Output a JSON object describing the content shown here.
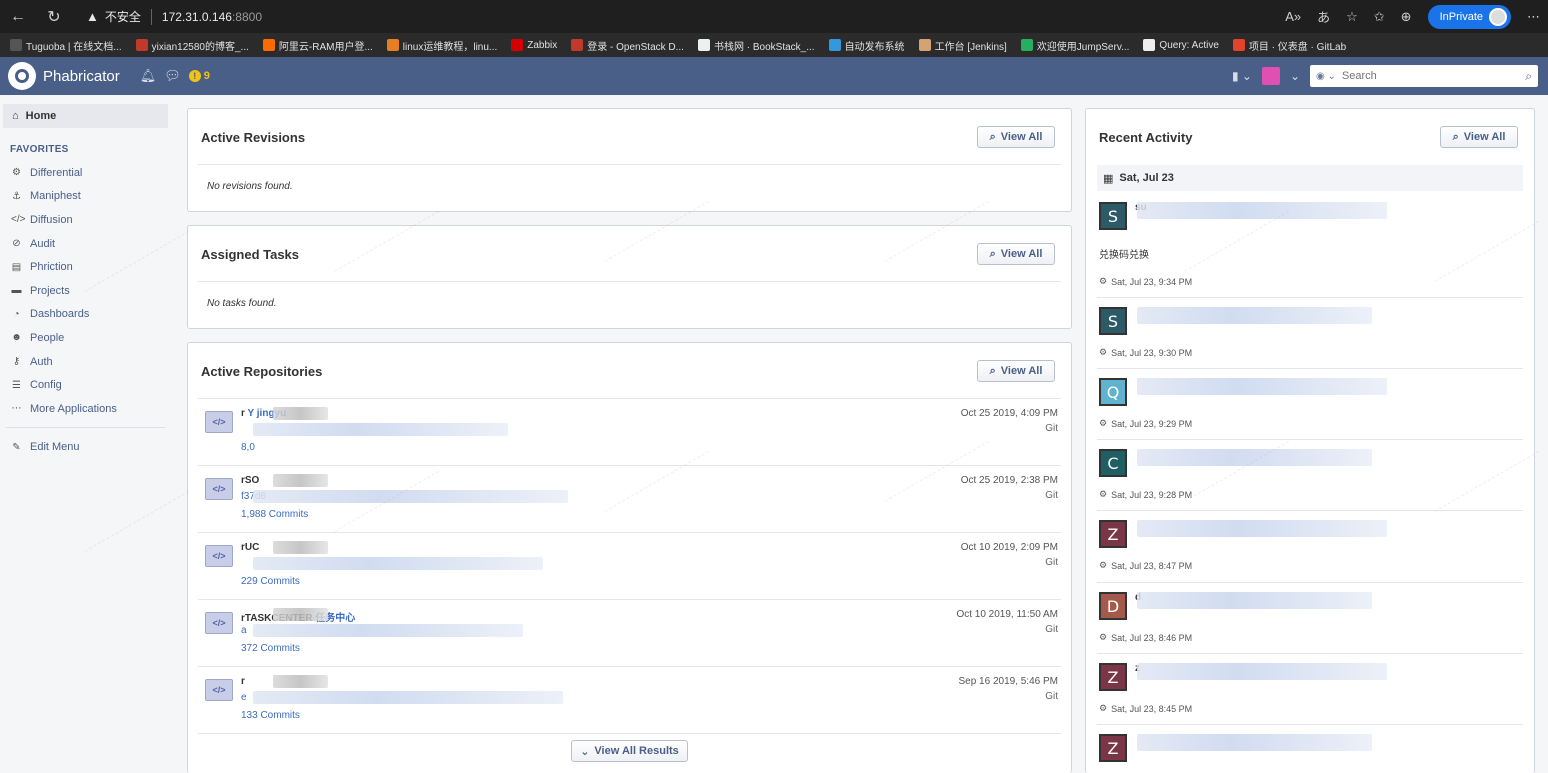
{
  "browser": {
    "insecure_label": "不安全",
    "url": "172.31.0.146",
    "port": ":8800",
    "inprivate_label": "InPrivate"
  },
  "bookmarks": [
    {
      "label": "Tuguoba | 在线文档...",
      "color": "#555555"
    },
    {
      "label": "yixian12580的博客_...",
      "color": "#c0392b"
    },
    {
      "label": "阿里云-RAM用户登...",
      "color": "#ff6a00"
    },
    {
      "label": "linux运维教程，linu...",
      "color": "#e67e22"
    },
    {
      "label": "Zabbix",
      "color": "#d40000"
    },
    {
      "label": "登录 - OpenStack D...",
      "color": "#c0392b"
    },
    {
      "label": "书栈网 · BookStack_...",
      "color": "#ecf0f1"
    },
    {
      "label": "自动发布系统",
      "color": "#3498db"
    },
    {
      "label": "工作台 [Jenkins]",
      "color": "#d4a373"
    },
    {
      "label": "欢迎使用JumpServ...",
      "color": "#27ae60"
    },
    {
      "label": "Query: Active",
      "color": "#eeeeee"
    },
    {
      "label": "项目 · 仪表盘 · GitLab",
      "color": "#e24329"
    }
  ],
  "header": {
    "brand": "Phabricator",
    "alert_count": "9",
    "search_placeholder": "Search"
  },
  "sidebar": {
    "home_label": "Home",
    "favorites_heading": "FAVORITES",
    "items": [
      {
        "label": "Differential",
        "icon": "gear-icon",
        "glyph": "⚙"
      },
      {
        "label": "Maniphest",
        "icon": "anchor-icon",
        "glyph": "⚓"
      },
      {
        "label": "Diffusion",
        "icon": "code-icon",
        "glyph": "</>"
      },
      {
        "label": "Audit",
        "icon": "check-circle-icon",
        "glyph": "⊘"
      },
      {
        "label": "Phriction",
        "icon": "book-icon",
        "glyph": "▤"
      },
      {
        "label": "Projects",
        "icon": "briefcase-icon",
        "glyph": "▬"
      },
      {
        "label": "Dashboards",
        "icon": "dashboard-icon",
        "glyph": "◔"
      },
      {
        "label": "People",
        "icon": "users-icon",
        "glyph": "☻"
      },
      {
        "label": "Auth",
        "icon": "key-icon",
        "glyph": "⚷"
      },
      {
        "label": "Config",
        "icon": "sliders-icon",
        "glyph": "☰"
      },
      {
        "label": "More Applications",
        "icon": "ellipsis-icon",
        "glyph": "⋯"
      }
    ],
    "edit_menu_label": "Edit Menu"
  },
  "active_revisions": {
    "title": "Active Revisions",
    "button": "View All",
    "empty": "No revisions found."
  },
  "assigned_tasks": {
    "title": "Assigned Tasks",
    "button": "View All",
    "empty": "No tasks found."
  },
  "active_repositories": {
    "title": "Active Repositories",
    "button": "View All",
    "footer_button": "View All Results",
    "repos": [
      {
        "name": "r",
        "desc": "Y jingyu",
        "hash": "",
        "commits": "8,0",
        "date": "Oct 25 2019, 4:09 PM",
        "vcs": "Git"
      },
      {
        "name": "rSO",
        "desc": "",
        "hash": "f37d6",
        "commits": "1,988 Commits",
        "date": "Oct 25 2019, 2:38 PM",
        "vcs": "Git"
      },
      {
        "name": "rUC",
        "desc": "",
        "hash": "",
        "commits": "229 Commits",
        "date": "Oct 10 2019, 2:09 PM",
        "vcs": "Git"
      },
      {
        "name": "rTASKCENTER",
        "desc": "任务中心",
        "hash": "a",
        "commits": "372 Commits",
        "date": "Oct 10 2019, 11:50 AM",
        "vcs": "Git"
      },
      {
        "name": "r",
        "desc": "",
        "hash": "e",
        "commits": "133 Commits",
        "date": "Sep 16 2019, 5:46 PM",
        "vcs": "Git"
      }
    ]
  },
  "recent_activity": {
    "title": "Recent Activity",
    "button": "View All",
    "day": "Sat, Jul 23",
    "items": [
      {
        "letter": "S",
        "color": "#2c5a66",
        "frag": "su",
        "extra": "兑换码兑换",
        "time": "Sat, Jul 23, 9:34 PM"
      },
      {
        "letter": "S",
        "color": "#2c5a66",
        "frag": "",
        "extra": "",
        "time": "Sat, Jul 23, 9:30 PM"
      },
      {
        "letter": "Q",
        "color": "#5fb3cf",
        "frag": "",
        "extra": "",
        "time": "Sat, Jul 23, 9:29 PM"
      },
      {
        "letter": "C",
        "color": "#1f5f63",
        "frag": "",
        "extra": "",
        "time": "Sat, Jul 23, 9:28 PM"
      },
      {
        "letter": "Z",
        "color": "#7a3546",
        "frag": "",
        "extra": "",
        "time": "Sat, Jul 23, 8:47 PM"
      },
      {
        "letter": "D",
        "color": "#a5594a",
        "frag": "d",
        "extra": "",
        "time": "Sat, Jul 23, 8:46 PM"
      },
      {
        "letter": "Z",
        "color": "#7a3546",
        "frag": "z",
        "extra": "",
        "time": "Sat, Jul 23, 8:45 PM"
      },
      {
        "letter": "Z",
        "color": "#7a3546",
        "frag": "",
        "extra": "",
        "time": ""
      }
    ]
  }
}
